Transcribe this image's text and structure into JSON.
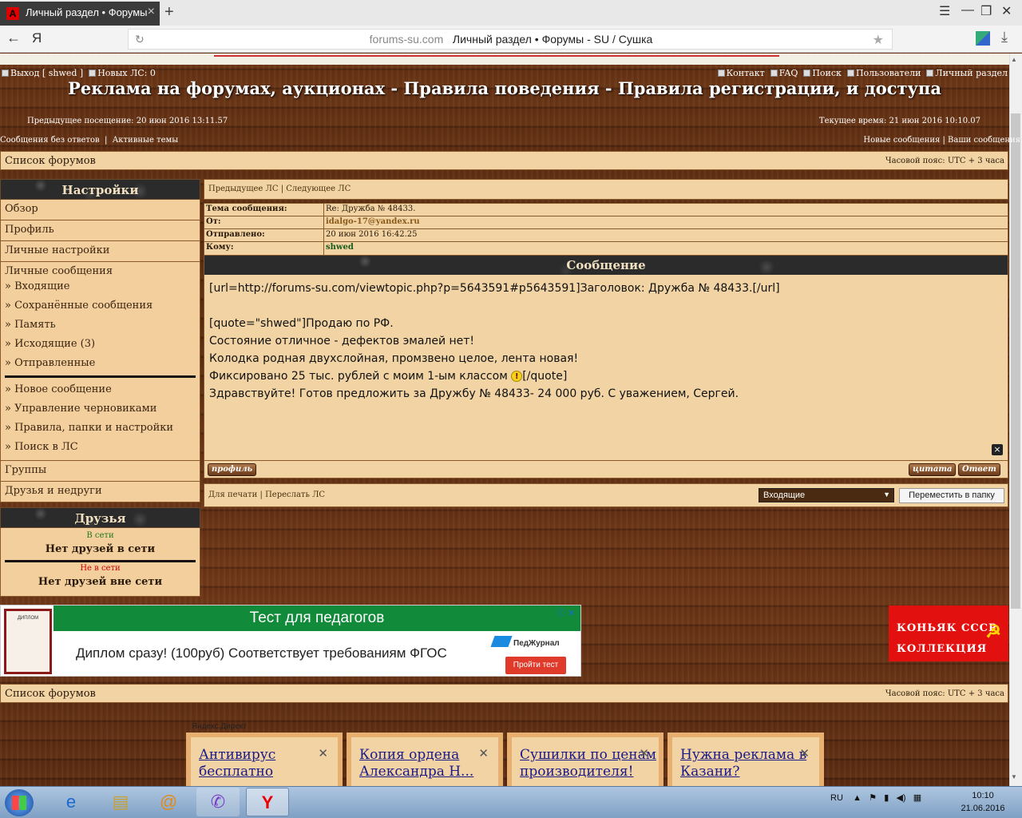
{
  "browser": {
    "tab_title": "Личный раздел • Форумы",
    "tab_icon": "А",
    "url_domain": "forums-su.com",
    "url_title": "Личный раздел • Форумы - SU / Сушка",
    "yandex_btn": "Я"
  },
  "header": {
    "logout": "Выход [ shwed ]",
    "new_pm": "Новых ЛС: 0",
    "nav": [
      "Контакт",
      "FAQ",
      "Поиск",
      "Пользователи",
      "Личный раздел"
    ],
    "site_title": "Реклама на форумах, аукционах - Правила поведения - Правила регистрации, и доступа",
    "prev_visit": "Предыдущее посещение: 20 июн 2016 13:11.57",
    "current_time": "Текущее время: 21 июн 2016 10:10.07",
    "links_left": [
      "Сообщения без ответов",
      "Активные темы"
    ],
    "links_right": [
      "Новые сообщения",
      "Ваши сообщения"
    ]
  },
  "navbar": {
    "forum_list": "Список форумов",
    "timezone": "Часовой пояс: UTC + 3 часа"
  },
  "sidebar": {
    "settings_title": "Настройки",
    "items_top": [
      "Обзор",
      "Профиль",
      "Личные настройки"
    ],
    "pm_title": "Личные сообщения",
    "pm_items_a": [
      "» Входящие",
      "» Сохранённые сообщения",
      "» Память",
      "» Исходящие (3)",
      "» Отправленные"
    ],
    "pm_items_b": [
      "» Новое сообщение",
      "» Управление черновиками",
      "» Правила, папки и настройки",
      "» Поиск в ЛС"
    ],
    "items_bottom": [
      "Группы",
      "Друзья и недруги"
    ],
    "friends_title": "Друзья",
    "online_label": "В сети",
    "no_online": "Нет друзей в сети",
    "offline_label": "Не в сети",
    "no_offline": "Нет друзей вне сети"
  },
  "message": {
    "nav": [
      "Предыдущее ЛС",
      "Следующее ЛС"
    ],
    "fields": [
      {
        "key": "Тема сообщения:",
        "value": "Re: Дружба № 48433."
      },
      {
        "key": "От:",
        "value": "idalgo-17@yandex.ru"
      },
      {
        "key": "Отправлено:",
        "value": "20 июн 2016 16:42.25"
      },
      {
        "key": "Кому:",
        "value": "shwed"
      }
    ],
    "body_title": "Сообщение",
    "body_lines": [
      "[url=http://forums-su.com/viewtopic.php?p=5643591#p5643591]Заголовок: Дружба № 48433.[/url]",
      "",
      "[quote=\"shwed\"]Продаю по РФ.",
      "Состояние отличное - дефектов эмалей нет!",
      "Колодка родная двухслойная, промзвено целое, лента новая!",
      "Фиксировано 25 тыс. рублей с моим 1-ым классом",
      "Здравствуйте! Готов предложить за Дружбу № 48433- 24 000 руб. С уважением, Сергей."
    ],
    "quote_end": "[/quote]",
    "profile_btn": "профиль",
    "quote_btn": "цитата",
    "reply_btn": "Ответ",
    "actions": [
      "Для печати",
      "Переслать ЛС"
    ],
    "folder_selected": "Входящие",
    "move_btn": "Переместить в папку"
  },
  "ad": {
    "title": "Тест для педагогов",
    "text": "Диплом сразу! (100руб) Соответствует требованиям ФГОС",
    "brand": "ПедЖурнал",
    "button": "Пройти тест",
    "img_label": "ДИПЛОМ"
  },
  "cognac": {
    "line1": "КОНЬЯК СССР",
    "line2": "КОЛЛЕКЦИЯ"
  },
  "direct": {
    "label": "Яндекс.Директ",
    "cards": [
      "Антивирус бесплатно",
      "Копия ордена Александра Н...",
      "Сушилки по ценам производителя!",
      "Нужна реклама в Казани?"
    ]
  },
  "taskbar": {
    "lang": "RU",
    "time": "10:10",
    "date": "21.06.2016"
  }
}
